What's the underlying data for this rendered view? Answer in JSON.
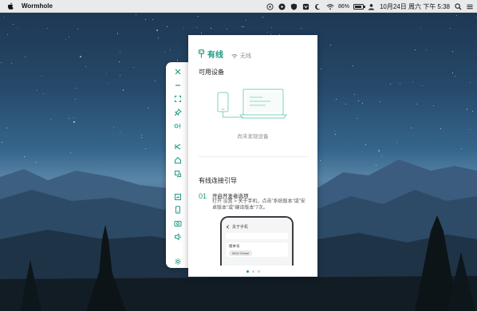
{
  "menubar": {
    "app_name": "Wormhole",
    "battery_text": "86%",
    "battery_level": 0.86,
    "clock": "10月24日 周六 下午 5:38"
  },
  "toolbar": {
    "items": [
      {
        "icon": "close-icon"
      },
      {
        "icon": "minimize-icon"
      },
      {
        "icon": "fullscreen-icon"
      },
      {
        "icon": "pin-icon"
      },
      {
        "icon": "connect-icon"
      },
      {
        "icon": "back-icon"
      },
      {
        "icon": "home-icon"
      },
      {
        "icon": "recent-apps-icon"
      },
      {
        "icon": "screenshot-icon"
      },
      {
        "icon": "phone-icon"
      },
      {
        "icon": "camera-icon"
      },
      {
        "icon": "volume-icon"
      },
      {
        "icon": "settings-icon"
      }
    ]
  },
  "panel": {
    "tab_wired": "有线",
    "tab_wireless": "无线",
    "available_title": "可用设备",
    "empty_text": "尚未发现设备",
    "guide_title": "有线连接引导",
    "step_number": "01",
    "step_title": "开启开发者选项",
    "step_desc": "打开 设置 > 关于手机，点击\"系统版本\"或\"安卓版本\"或\"编译版本\"7次。",
    "phone_header": "关于手机",
    "phone_card_title": "版本号",
    "phone_card_pill": "MIUI Global"
  },
  "pagination": {
    "total": 3,
    "current": 1
  },
  "colors": {
    "accent": "#1f9b84",
    "text": "#222222",
    "muted": "#8a8f94"
  }
}
